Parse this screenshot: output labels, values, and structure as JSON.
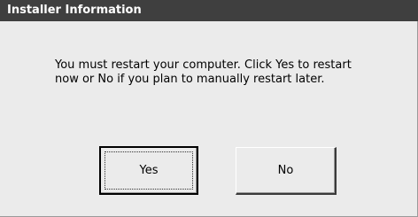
{
  "window": {
    "title": "Installer Information"
  },
  "message": {
    "line1": "You must restart your computer. Click Yes to restart",
    "line2": "now or No if you plan to manually restart later."
  },
  "buttons": {
    "yes_label": "Yes",
    "no_label": "No"
  },
  "colors": {
    "titlebar": "#3f3f3f",
    "dialog_background": "#ebebeb"
  }
}
